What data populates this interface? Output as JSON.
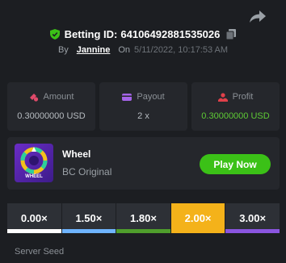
{
  "header": {
    "betting_id_label": "Betting ID:",
    "betting_id": "64106492881535026",
    "by_label": "By",
    "username": "Jannine",
    "on_label": "On",
    "date": "5/11/2022, 10:17:53 AM"
  },
  "stats": [
    {
      "label": "Amount",
      "value": "0.30000000 USD",
      "icon": "coins-icon"
    },
    {
      "label": "Payout",
      "value": "2 x",
      "icon": "wallet-icon"
    },
    {
      "label": "Profit",
      "value": "0.30000000 USD",
      "icon": "profit-icon",
      "value_color": "#5ecb35"
    }
  ],
  "game": {
    "name": "Wheel",
    "provider": "BC Original",
    "thumb_label": "WHEEL",
    "play_label": "Play Now"
  },
  "multipliers": [
    {
      "label": "0.00×",
      "color": "#ffffff",
      "active": false
    },
    {
      "label": "1.50×",
      "color": "#6fb4ff",
      "active": false
    },
    {
      "label": "1.80×",
      "color": "#4f9e2c",
      "active": false
    },
    {
      "label": "2.00×",
      "color": "#f4b21a",
      "active": true
    },
    {
      "label": "3.00×",
      "color": "#8a55e0",
      "active": false
    }
  ],
  "server_seed_label": "Server Seed",
  "colors": {
    "accent_green": "#3bc117",
    "background": "#1c1e22",
    "panel": "#25272c"
  }
}
